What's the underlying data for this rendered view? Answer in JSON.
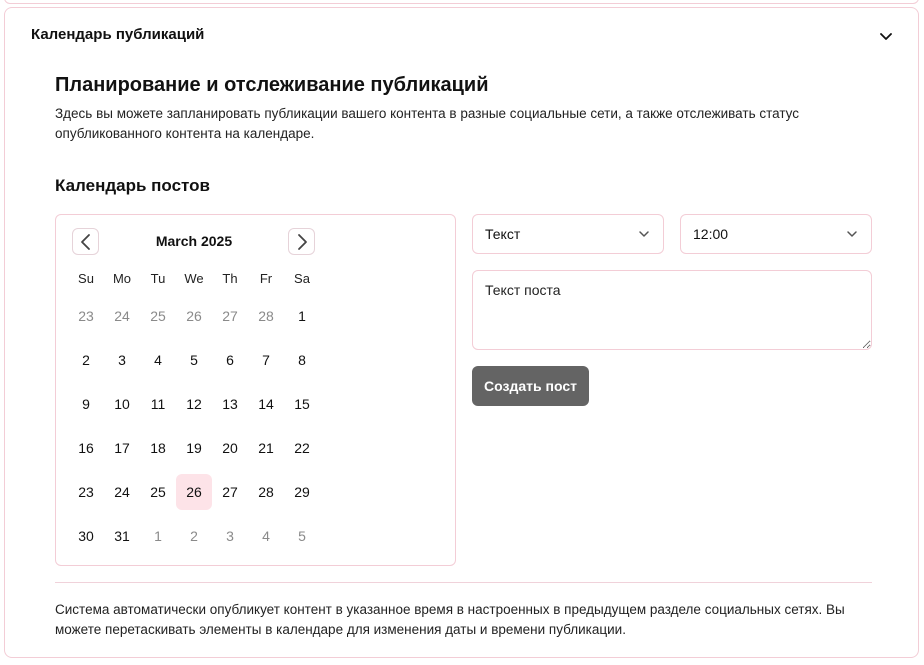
{
  "accordion": {
    "title": "Календарь публикаций",
    "toggle_icon": "chevron-down-icon"
  },
  "section": {
    "title": "Планирование и отслеживание публикаций",
    "description": "Здесь вы можете запланировать публикации вашего контента в разные социальные сети, а также отслеживать статус опубликованного контента на календаре."
  },
  "calendar": {
    "heading": "Календарь постов",
    "month_label": "March 2025",
    "prev_icon": "chevron-left-icon",
    "next_icon": "chevron-right-icon",
    "weekdays": [
      "Su",
      "Mo",
      "Tu",
      "We",
      "Th",
      "Fr",
      "Sa"
    ],
    "days": [
      {
        "label": "23",
        "outside": true
      },
      {
        "label": "24",
        "outside": true
      },
      {
        "label": "25",
        "outside": true
      },
      {
        "label": "26",
        "outside": true
      },
      {
        "label": "27",
        "outside": true
      },
      {
        "label": "28",
        "outside": true
      },
      {
        "label": "1",
        "outside": false
      },
      {
        "label": "2",
        "outside": false
      },
      {
        "label": "3",
        "outside": false
      },
      {
        "label": "4",
        "outside": false
      },
      {
        "label": "5",
        "outside": false
      },
      {
        "label": "6",
        "outside": false
      },
      {
        "label": "7",
        "outside": false
      },
      {
        "label": "8",
        "outside": false
      },
      {
        "label": "9",
        "outside": false
      },
      {
        "label": "10",
        "outside": false
      },
      {
        "label": "11",
        "outside": false
      },
      {
        "label": "12",
        "outside": false
      },
      {
        "label": "13",
        "outside": false
      },
      {
        "label": "14",
        "outside": false
      },
      {
        "label": "15",
        "outside": false
      },
      {
        "label": "16",
        "outside": false
      },
      {
        "label": "17",
        "outside": false
      },
      {
        "label": "18",
        "outside": false
      },
      {
        "label": "19",
        "outside": false
      },
      {
        "label": "20",
        "outside": false
      },
      {
        "label": "21",
        "outside": false
      },
      {
        "label": "22",
        "outside": false
      },
      {
        "label": "23",
        "outside": false
      },
      {
        "label": "24",
        "outside": false
      },
      {
        "label": "25",
        "outside": false
      },
      {
        "label": "26",
        "outside": false,
        "selected": true
      },
      {
        "label": "27",
        "outside": false
      },
      {
        "label": "28",
        "outside": false
      },
      {
        "label": "29",
        "outside": false
      },
      {
        "label": "30",
        "outside": false
      },
      {
        "label": "31",
        "outside": false
      },
      {
        "label": "1",
        "outside": true
      },
      {
        "label": "2",
        "outside": true
      },
      {
        "label": "3",
        "outside": true
      },
      {
        "label": "4",
        "outside": true
      },
      {
        "label": "5",
        "outside": true
      }
    ]
  },
  "form": {
    "content_type_value": "Текст",
    "time_value": "12:00",
    "dropdown_icon": "chevron-down-icon",
    "post_text_placeholder": "Текст поста",
    "create_button_label": "Создать пост"
  },
  "footer": {
    "note": "Система автоматически опубликует контент в указанное время в настроенных в предыдущем разделе социальных сетях. Вы можете перетаскивать элементы в календаре для изменения даты и времени публикации."
  },
  "colors": {
    "border": "#f3cdd6",
    "selected_day_bg": "#fde3e8",
    "button_bg": "#646464",
    "outside_day_text": "#8a8a8a"
  }
}
